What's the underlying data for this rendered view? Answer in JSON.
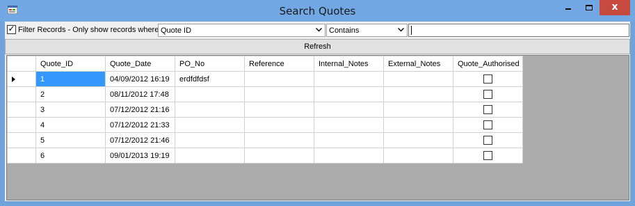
{
  "window": {
    "title": "Search Quotes",
    "close_glyph": "x"
  },
  "filter": {
    "checked": true,
    "label": "Filter Records - Only show records where",
    "field_value": "Quote ID",
    "operator_value": "Contains",
    "search_value": ""
  },
  "refresh_label": "Refresh",
  "grid": {
    "columns": [
      "Quote_ID",
      "Quote_Date",
      "PO_No",
      "Reference",
      "Internal_Notes",
      "External_Notes",
      "Quote_Authorised"
    ],
    "rows": [
      {
        "quote_id": "1",
        "quote_date": "04/09/2012 16:19",
        "po_no": "erdfdfdsf",
        "reference": "",
        "internal_notes": "",
        "external_notes": "",
        "quote_authorised": false
      },
      {
        "quote_id": "2",
        "quote_date": "08/11/2012 17:48",
        "po_no": "",
        "reference": "",
        "internal_notes": "",
        "external_notes": "",
        "quote_authorised": false
      },
      {
        "quote_id": "3",
        "quote_date": "07/12/2012 21:16",
        "po_no": "",
        "reference": "",
        "internal_notes": "",
        "external_notes": "",
        "quote_authorised": false
      },
      {
        "quote_id": "4",
        "quote_date": "07/12/2012 21:33",
        "po_no": "",
        "reference": "",
        "internal_notes": "",
        "external_notes": "",
        "quote_authorised": false
      },
      {
        "quote_id": "5",
        "quote_date": "07/12/2012 21:46",
        "po_no": "",
        "reference": "",
        "internal_notes": "",
        "external_notes": "",
        "quote_authorised": false
      },
      {
        "quote_id": "6",
        "quote_date": "09/01/2013 19:19",
        "po_no": "",
        "reference": "",
        "internal_notes": "",
        "external_notes": "",
        "quote_authorised": false
      }
    ],
    "current_row": 0,
    "selection_color": "#3399ff"
  },
  "colors": {
    "titlebar": "#71a7e2",
    "close_button": "#c74a3f",
    "grid_background": "#ababab"
  }
}
